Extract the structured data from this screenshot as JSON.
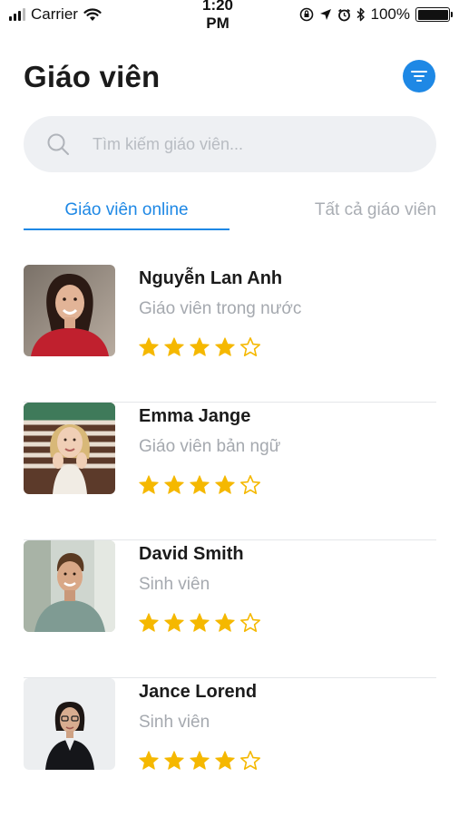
{
  "status_bar": {
    "carrier": "Carrier",
    "time": "1:20 PM",
    "battery": "100%"
  },
  "header": {
    "title": "Giáo viên",
    "filter_icon": "filter-lines-icon"
  },
  "search": {
    "placeholder": "Tìm kiếm giáo viên...",
    "value": ""
  },
  "tabs": [
    {
      "label": "Giáo viên online",
      "active": true
    },
    {
      "label": "Tất cả giáo viên",
      "active": false
    }
  ],
  "teachers": [
    {
      "name": "Nguyễn Lan Anh",
      "role": "Giáo viên trong nước",
      "rating": 4,
      "max_rating": 5
    },
    {
      "name": "Emma Jange",
      "role": "Giáo viên bản ngữ",
      "rating": 4,
      "max_rating": 5
    },
    {
      "name": "David Smith",
      "role": "Sinh viên",
      "rating": 4,
      "max_rating": 5
    },
    {
      "name": "Jance Lorend",
      "role": "Sinh viên",
      "rating": 4,
      "max_rating": 5
    }
  ],
  "colors": {
    "accent": "#1e88e5",
    "star": "#f5b800",
    "search_bg": "#eef0f3",
    "muted_text": "#a5a9af"
  }
}
